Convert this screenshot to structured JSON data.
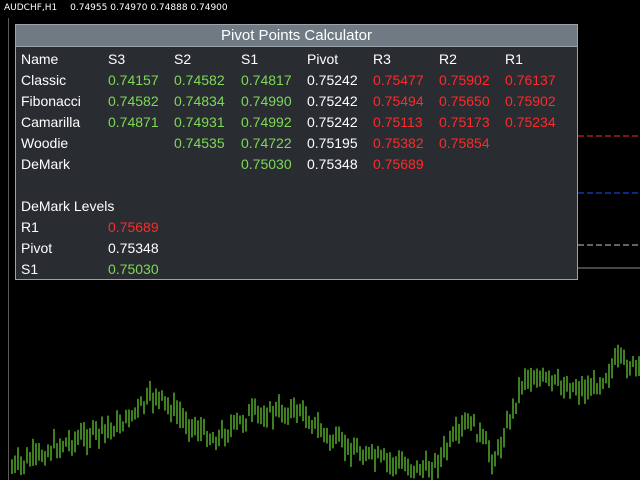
{
  "chart": {
    "symbol": "AUDCHF,H1",
    "ohlc": [
      "0.74955",
      "0.74970",
      "0.74888",
      "0.74900"
    ],
    "colors": {
      "background": "#000000",
      "candle": "#7dff3c",
      "line_red": "#ff2a2a",
      "line_blue": "#1e50ff",
      "line_white": "#c8c8c8"
    }
  },
  "panel": {
    "title": "Pivot Points Calculator",
    "headers": [
      "Name",
      "S3",
      "S2",
      "S1",
      "Pivot",
      "R3",
      "R2",
      "R1"
    ],
    "rows": [
      {
        "name": "Classic",
        "values": [
          "0.74157",
          "0.74582",
          "0.74817",
          "0.75242",
          "0.75477",
          "0.75902",
          "0.76137"
        ]
      },
      {
        "name": "Fibonacci",
        "values": [
          "0.74582",
          "0.74834",
          "0.74990",
          "0.75242",
          "0.75494",
          "0.75650",
          "0.75902"
        ]
      },
      {
        "name": "Camarilla",
        "values": [
          "0.74871",
          "0.74931",
          "0.74992",
          "0.75242",
          "0.75113",
          "0.75173",
          "0.75234"
        ]
      },
      {
        "name": "Woodie",
        "values": [
          "",
          "0.74535",
          "0.74722",
          "0.75195",
          "0.75382",
          "0.75854",
          ""
        ]
      },
      {
        "name": "DeMark",
        "values": [
          "",
          "",
          "0.75030",
          "0.75348",
          "0.75689",
          "",
          ""
        ]
      }
    ],
    "demark": {
      "title": "DeMark Levels",
      "levels": [
        {
          "label": "R1",
          "value": "0.75689"
        },
        {
          "label": "Pivot",
          "value": "0.75348"
        },
        {
          "label": "S1",
          "value": "0.75030"
        }
      ]
    },
    "colors": {
      "support": "#7ed957",
      "pivot": "#ffffff",
      "resistance": "#ff2a2a",
      "title_bar": "#6f7a84",
      "panel_bg": "#292c31"
    }
  }
}
